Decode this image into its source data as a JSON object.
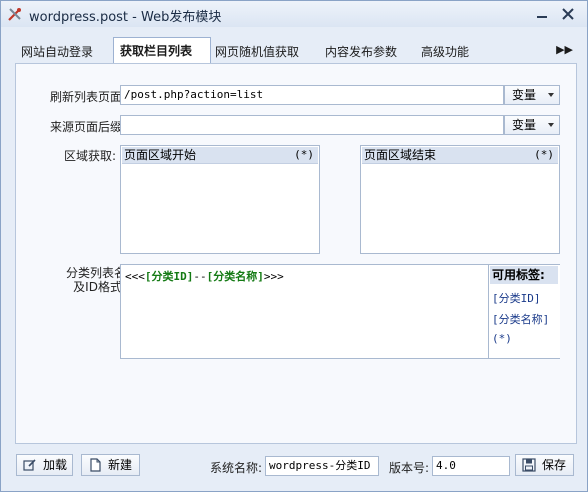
{
  "window": {
    "title": "wordpress.post - Web发布模块"
  },
  "tabs": [
    {
      "label": "网站自动登录",
      "active": false
    },
    {
      "label": "获取栏目列表",
      "active": true
    },
    {
      "label": "网页随机值获取",
      "active": false
    },
    {
      "label": "内容发布参数",
      "active": false
    },
    {
      "label": "高级功能",
      "active": false
    }
  ],
  "tab_more": "▶▶",
  "form": {
    "refresh_label": "刷新列表页面:",
    "refresh_value": "/post.php?action=list",
    "refresh_btn": "变量",
    "suffix_label": "来源页面后缀:",
    "suffix_value": "",
    "suffix_btn": "变量",
    "region_label": "区域获取:",
    "region_start_title": "页面区域开始",
    "region_start_tag": "(*)",
    "region_end_title": "页面区域结束",
    "region_end_tag": "(*)",
    "format_label_line1": "分类列表名",
    "format_label_line2": "及ID格式:",
    "format_prefix": "<<<",
    "format_id": "[分类ID]",
    "format_sep": "--",
    "format_name": "[分类名称]",
    "format_suffix": ">>>",
    "tags_title": "可用标签:",
    "tags": [
      "[分类ID]",
      "[分类名称]",
      "(*)"
    ]
  },
  "footer": {
    "load_btn": "加载",
    "new_btn": "新建",
    "sysname_label": "系统名称:",
    "sysname_value": "wordpress-分类ID",
    "version_label": "版本号:",
    "version_value": "4.0",
    "save_btn": "保存"
  },
  "colors": {
    "accent": "#1a3a8a",
    "format_tag": "#147a14",
    "panel_border": "#b7c6dc"
  }
}
